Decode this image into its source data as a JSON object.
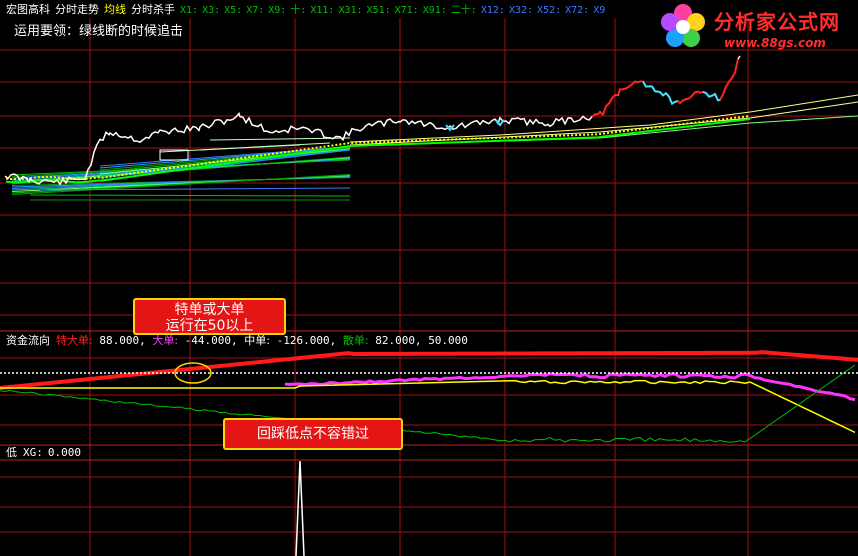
{
  "header": {
    "items": [
      {
        "label": "宏图高科",
        "color": "#ffffff"
      },
      {
        "label": "分时走势",
        "color": "#ffffff"
      },
      {
        "label": "均线",
        "color": "#ffff00"
      },
      {
        "label": "分时杀手",
        "color": "#ffffff"
      }
    ],
    "xlines": [
      {
        "label": "X1:",
        "color": "#00c000"
      },
      {
        "label": "X3:",
        "color": "#00c000"
      },
      {
        "label": "X5:",
        "color": "#00c000"
      },
      {
        "label": "X7:",
        "color": "#00c000"
      },
      {
        "label": "X9:",
        "color": "#00c000"
      },
      {
        "label": "十:",
        "color": "#00c000"
      },
      {
        "label": "X11:",
        "color": "#00c000"
      },
      {
        "label": "X31:",
        "color": "#00c000"
      },
      {
        "label": "X51:",
        "color": "#00c000"
      },
      {
        "label": "X71:",
        "color": "#00c000"
      },
      {
        "label": "X91:",
        "color": "#00c000"
      },
      {
        "label": "二十:",
        "color": "#00c000"
      },
      {
        "label": "X12:",
        "color": "#3a7bff"
      },
      {
        "label": "X32:",
        "color": "#3a7bff"
      },
      {
        "label": "X52:",
        "color": "#3a7bff"
      },
      {
        "label": "X72:",
        "color": "#3a7bff"
      },
      {
        "label": "X9",
        "color": "#3a7bff"
      }
    ]
  },
  "tip": "运用要领：绿线断的时候追击",
  "panel2": {
    "title": "资金流向",
    "entries": [
      {
        "label": "特大单:",
        "value": "88.000,",
        "color": "#ff2020"
      },
      {
        "label": "大单:",
        "value": "-44.000,",
        "color": "#ff40ff"
      },
      {
        "label": "中单:",
        "value": "-126.000,",
        "color": "#ffffff"
      },
      {
        "label": "散单:",
        "value": "82.000,",
        "color": "#00c000"
      },
      {
        "label": "",
        "value": "50.000",
        "color": "#ffffff"
      }
    ]
  },
  "panel3": {
    "title": "低",
    "label": "XG:",
    "value": "0.000"
  },
  "callouts": {
    "top": {
      "line1": "特单或大单",
      "line2": "运行在50以上"
    },
    "bottom": {
      "text": "回踩低点不容错过"
    }
  },
  "logo": {
    "title": "分析家公式网",
    "url": "www.88gs.com"
  },
  "colors": {
    "grid": "#a01010",
    "price": "#ffffff",
    "avg": "#ffff00",
    "superlarge": "#ff1a1a",
    "large": "#ff33ff",
    "medium": "#ffff00",
    "retail": "#00c000"
  }
}
